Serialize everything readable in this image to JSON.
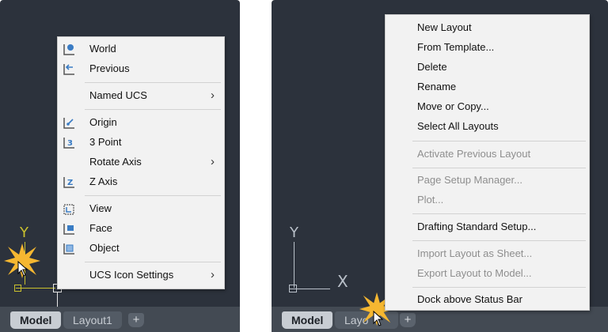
{
  "left": {
    "tabs": [
      {
        "label": "Model",
        "active": true
      },
      {
        "label": "Layout1",
        "active": false
      }
    ],
    "add_tab": "+",
    "axis_y_label": "Y",
    "menu": [
      {
        "id": "world",
        "label": "World",
        "icon": "ucs-world-icon"
      },
      {
        "id": "previous",
        "label": "Previous",
        "icon": "ucs-previous-icon"
      },
      {
        "sep": true
      },
      {
        "id": "named-ucs",
        "label": "Named UCS",
        "submenu": true
      },
      {
        "sep": true
      },
      {
        "id": "origin",
        "label": "Origin",
        "icon": "ucs-origin-icon"
      },
      {
        "id": "3-point",
        "label": "3 Point",
        "icon": "ucs-3point-icon"
      },
      {
        "id": "rotate-axis",
        "label": "Rotate Axis",
        "submenu": true
      },
      {
        "id": "z-axis",
        "label": "Z Axis",
        "icon": "ucs-zaxis-icon"
      },
      {
        "sep": true
      },
      {
        "id": "view",
        "label": "View",
        "icon": "ucs-view-icon"
      },
      {
        "id": "face",
        "label": "Face",
        "icon": "ucs-face-icon"
      },
      {
        "id": "object",
        "label": "Object",
        "icon": "ucs-object-icon"
      },
      {
        "sep": true
      },
      {
        "id": "ucs-icon-settings",
        "label": "UCS Icon Settings",
        "submenu": true
      }
    ]
  },
  "right": {
    "tabs": [
      {
        "label": "Model",
        "active": true
      },
      {
        "label": "Layo",
        "active": false
      }
    ],
    "add_tab": "+",
    "axis_y_label": "Y",
    "axis_x_label": "X",
    "menu": [
      {
        "id": "new-layout",
        "label": "New Layout"
      },
      {
        "id": "from-template",
        "label": "From Template..."
      },
      {
        "id": "delete",
        "label": "Delete"
      },
      {
        "id": "rename",
        "label": "Rename"
      },
      {
        "id": "move-or-copy",
        "label": "Move or Copy..."
      },
      {
        "id": "select-all-layouts",
        "label": "Select All Layouts"
      },
      {
        "sep": true
      },
      {
        "id": "activate-previous-layout",
        "label": "Activate Previous Layout",
        "disabled": true
      },
      {
        "sep": true
      },
      {
        "id": "page-setup-manager",
        "label": "Page Setup Manager...",
        "disabled": true
      },
      {
        "id": "plot",
        "label": "Plot...",
        "disabled": true
      },
      {
        "sep": true
      },
      {
        "id": "drafting-standard-setup",
        "label": "Drafting Standard Setup..."
      },
      {
        "sep": true
      },
      {
        "id": "import-layout-as-sheet",
        "label": "Import Layout as Sheet...",
        "disabled": true
      },
      {
        "id": "export-layout-to-model",
        "label": "Export Layout to Model...",
        "disabled": true
      },
      {
        "sep": true
      },
      {
        "id": "dock-above-status-bar",
        "label": "Dock above Status Bar"
      }
    ]
  },
  "colors": {
    "canvas": "#2c323c",
    "menu_bg": "#f2f2f2",
    "ucs_axis_yellow": "#c9c02e",
    "icon_blue": "#3a7cc4",
    "burst": "#f5b731"
  }
}
